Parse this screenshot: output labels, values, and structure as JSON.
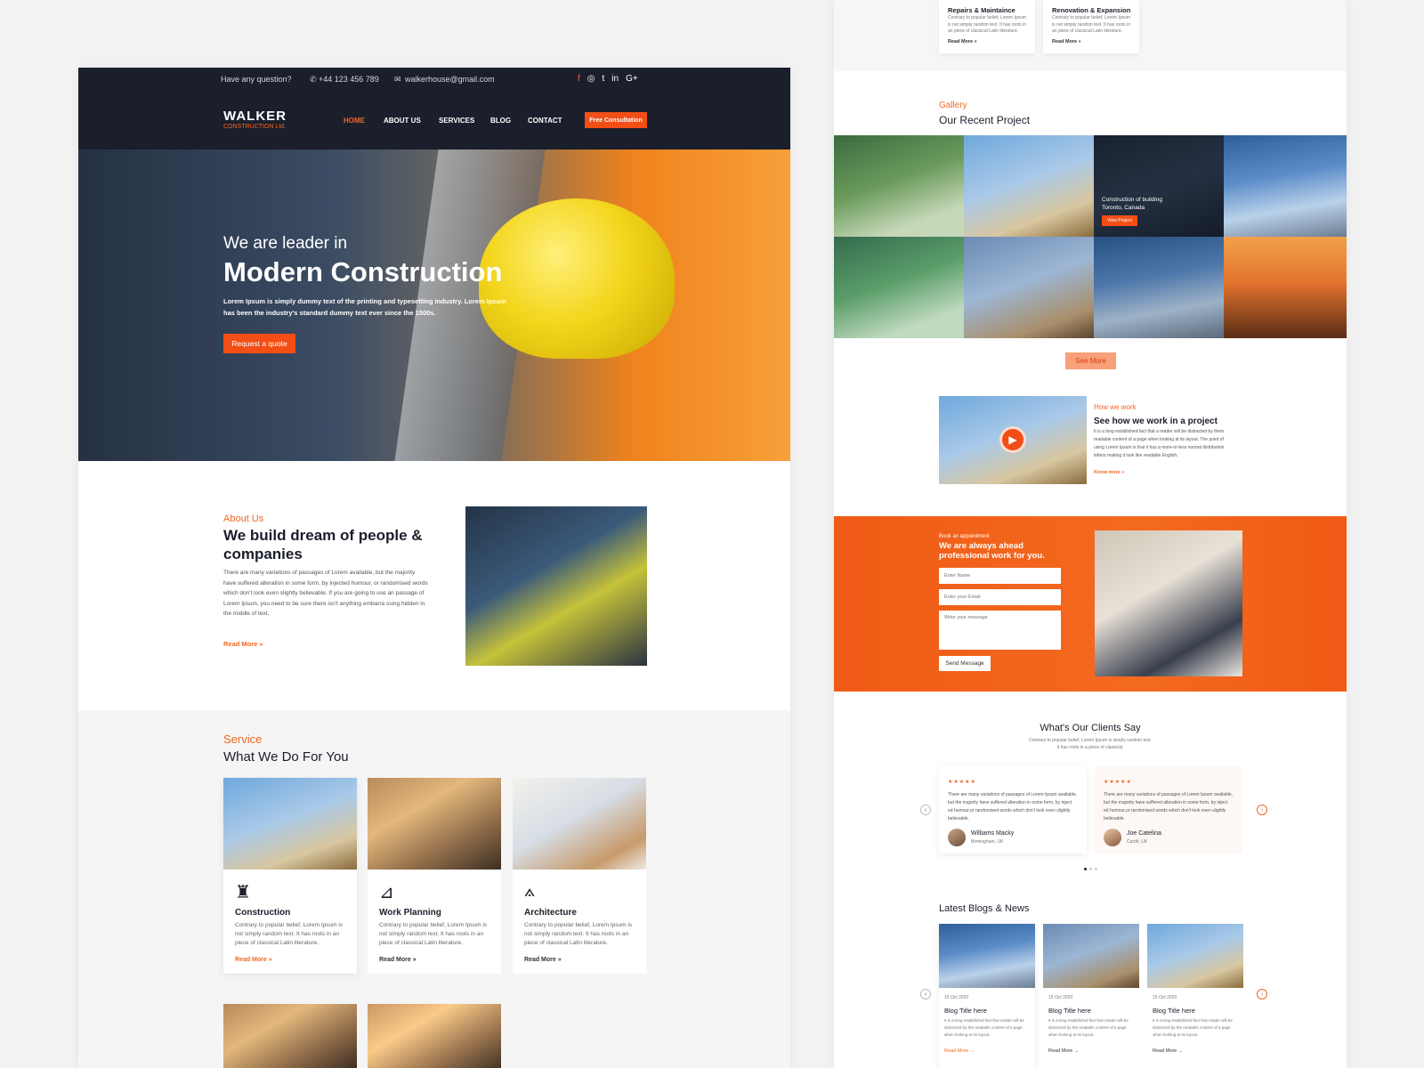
{
  "left": {
    "topbar": {
      "question": "Have any question?",
      "phone": "+44 123 456 789",
      "email": "walkerhouse@gmail.com",
      "social": [
        "f",
        "◎",
        "t",
        "in",
        "G+"
      ]
    },
    "logo": {
      "name": "WALKER",
      "sub": "CONSTRUCTION Ltd."
    },
    "nav": [
      "HOME",
      "ABOUT US",
      "SERVICES",
      "BLOG",
      "CONTACT"
    ],
    "cta": "Free Consultation",
    "hero": {
      "kicker": "We are leader in",
      "title": "Modern Construction",
      "text": "Lorem Ipsum is simply dummy text of the printing and typesetting industry. Lorem Ipsum has been the industry's standard dummy text ever since the 1500s.",
      "button": "Request a quote"
    },
    "about": {
      "eyebrow": "About Us",
      "title": "We build dream of people & companies",
      "text": "There are many variations of passages of Lorem available, but the majority have suffered alteration in some form, by injected humour, or randomised words which don't look even slightly believable. If you are going to use an passage of Lorem Ipsum, you need to be sure there isn't anything embarra ssing hidden in the middle of text.",
      "more": "Read More »"
    },
    "service": {
      "eyebrow": "Service",
      "title": "What We Do For You",
      "cards": [
        {
          "title": "Construction",
          "text": "Contrary to popular belief, Lorem Ipsum is not simply random text. It has roots in an piece of classical Latin literature.",
          "more": "Read More »",
          "icon": "crane-icon"
        },
        {
          "title": "Work Planning",
          "text": "Contrary to popular belief, Lorem Ipsum is not simply random text. It has roots in an piece of classical Latin literature.",
          "more": "Read More »",
          "icon": "blueprint-icon"
        },
        {
          "title": "Architecture",
          "text": "Contrary to popular belief, Lorem Ipsum is not simply random text. It has roots in an piece of classical Latin literature.",
          "more": "Read More »",
          "icon": "compass-icon"
        }
      ]
    }
  },
  "right": {
    "top_cards": [
      {
        "title": "Repairs & Maintaince",
        "text": "Contrary to popular belief, Lorem Ipsum is not simply random text. It has roots in an piece of classical Latin literature.",
        "more": "Read More »"
      },
      {
        "title": "Renovation & Expansion",
        "text": "Contrary to popular belief, Lorem Ipsum is not simply random text. It has roots in an piece of classical Latin literature.",
        "more": "Read More »"
      }
    ],
    "gallery": {
      "eyebrow": "Gallery",
      "title": "Our Recent Project",
      "caption_line1": "Construction of building",
      "caption_line2": "Toronto, Canada",
      "caption_button": "View Project",
      "see_more": "See More"
    },
    "how": {
      "eyebrow": "How we work",
      "title": "See how we work in a project",
      "text": "It is a long established fact that a reader will be distracted by them readable content of a page when looking at its layout. The point of using Lorem Ipsum is that it has a more-or-less normal distribution letters making it look like readable English.",
      "more": "Know more »"
    },
    "appointment": {
      "eyebrow": "Book an appointment",
      "title": "We are always ahead professional work for you.",
      "name_placeholder": "Enter Name",
      "email_placeholder": "Enter your Email",
      "message_placeholder": "Write your message",
      "button": "Send Message"
    },
    "clients": {
      "title": "What's Our Clients Say",
      "subtitle": "Contrary to popular belief, Lorem Ipsum is simply random text. It has roots in a piece of classical.",
      "stars": "★★★★★",
      "cards": [
        {
          "text": "There are many variations of passages of Lorem Ipsum available, but the majority have suffered alteration in some form, by inject ed humour,or randomised words which don't look even slightly believable.",
          "name": "Williams Macky",
          "location": "Birmingham, UK"
        },
        {
          "text": "There are many variations of passages of Lorem Ipsum available, but the majority have suffered alteration in some form, by inject ed humour,or randomised words which don't look even slightly believable.",
          "name": "Joe Catelina",
          "location": "Cardif, UK"
        }
      ]
    },
    "blogs": {
      "title": "Latest Blogs & News",
      "cards": [
        {
          "date": "15 Oct 2020",
          "title": "Blog Title here",
          "text": "It is a long established fact that reader will be distracted by the readable content of a page when looking at its layout.",
          "more": "Read More →"
        },
        {
          "date": "15 Oct 2020",
          "title": "Blog Title here",
          "text": "It is a long established fact that reader will be distracted by the readable content of a page when looking at its layout.",
          "more": "Read More →"
        },
        {
          "date": "15 Oct 2020",
          "title": "Blog Title here",
          "text": "It is a long established fact that reader will be distracted by the readable content of a page when looking at its layout.",
          "more": "Read More →"
        }
      ]
    }
  },
  "colors": {
    "accent": "#f26722",
    "dark": "#1b1e2b",
    "cta": "#f24e16"
  }
}
